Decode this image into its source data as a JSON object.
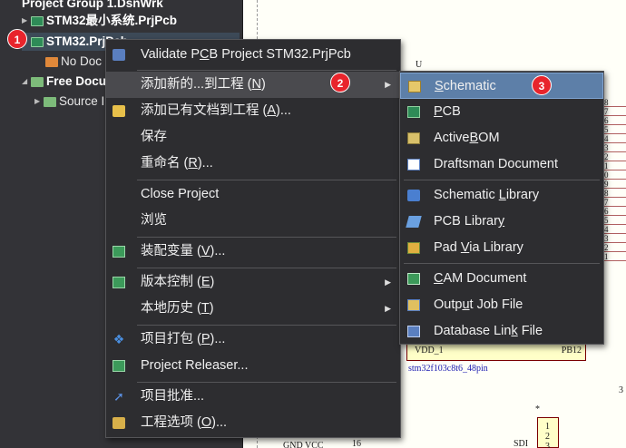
{
  "project_tree": {
    "group_label": "Project Group 1.DsnWrk",
    "items": [
      {
        "label": "STM32最小系统.PrjPcb"
      },
      {
        "label": "STM32.PrjPcb"
      },
      {
        "label": "No Doc"
      },
      {
        "label": "Free Docu"
      },
      {
        "label": "Source I"
      }
    ]
  },
  "context_menu": {
    "items": [
      {
        "pre": "Validate P",
        "u": "C",
        "post": "B Project STM32.PrjPcb",
        "icon": "validate-icon"
      },
      {
        "pre": "添加新的...到工程 (",
        "u": "N",
        "post": ")",
        "icon": "",
        "submenu": true
      },
      {
        "pre": "添加已有文档到工程 (",
        "u": "A",
        "post": ")...",
        "icon": "add-existing-icon"
      },
      {
        "pre": "保存",
        "u": "",
        "post": "",
        "icon": ""
      },
      {
        "pre": "重命名 (",
        "u": "R",
        "post": ")...",
        "icon": ""
      },
      {
        "pre": "Close Project",
        "u": "",
        "post": "",
        "icon": ""
      },
      {
        "pre": "浏览",
        "u": "",
        "post": "",
        "icon": ""
      },
      {
        "pre": "装配变量 (",
        "u": "V",
        "post": ")...",
        "icon": "variants-icon"
      },
      {
        "pre": "版本控制 (",
        "u": "E",
        "post": ")",
        "icon": "version-control-icon",
        "submenu": true
      },
      {
        "pre": "本地历史 (",
        "u": "T",
        "post": ")",
        "icon": "",
        "submenu": true
      },
      {
        "pre": "项目打包 (",
        "u": "P",
        "post": ")...",
        "icon": "dropbox-icon"
      },
      {
        "pre": "Project Releaser...",
        "u": "",
        "post": "",
        "icon": "releaser-icon"
      },
      {
        "pre": "项目批准...",
        "u": "",
        "post": "",
        "icon": "approve-icon"
      },
      {
        "pre": "工程选项 (",
        "u": "O",
        "post": ")...",
        "icon": "options-icon"
      }
    ]
  },
  "submenu": {
    "items": [
      {
        "pre": "",
        "u": "S",
        "post": "chematic",
        "icon": "schematic-icon"
      },
      {
        "pre": "",
        "u": "P",
        "post": "CB",
        "icon": "pcb-icon"
      },
      {
        "pre": "Active",
        "u": "B",
        "post": "OM",
        "icon": "activebom-icon"
      },
      {
        "pre": "Draftsman Document",
        "u": "",
        "post": "",
        "icon": "draftsman-icon"
      },
      {
        "pre": "Schematic ",
        "u": "L",
        "post": "ibrary",
        "icon": "schematic-library-icon"
      },
      {
        "pre": "PCB Librar",
        "u": "y",
        "post": "",
        "icon": "pcb-library-icon"
      },
      {
        "pre": "Pad ",
        "u": "V",
        "post": "ia Library",
        "icon": "pad-via-library-icon"
      },
      {
        "pre": "",
        "u": "C",
        "post": "AM Document",
        "icon": "cam-icon"
      },
      {
        "pre": "Outp",
        "u": "u",
        "post": "t Job File",
        "icon": "output-job-icon"
      },
      {
        "pre": "Database Lin",
        "u": "k",
        "post": " File",
        "icon": "database-link-icon"
      }
    ]
  },
  "badges": [
    "1",
    "2",
    "3"
  ],
  "schematic": {
    "ref_u": "U",
    "pin_left": "VDD_1",
    "pin_right": "PB12",
    "part": "stm32f103c8t6_48pin",
    "pin_nums": [
      "8",
      "7",
      "6",
      "5",
      "4",
      "3",
      "2",
      "1",
      "0",
      "9",
      "8",
      "7",
      "6",
      "5",
      "4",
      "3",
      "2",
      "1"
    ],
    "label_3": "3",
    "bottom_left": "GND    VCC",
    "bottom_num": "16",
    "sdi": "SDI",
    "conn_pins": [
      "1",
      "2",
      "3"
    ],
    "star": "*"
  }
}
